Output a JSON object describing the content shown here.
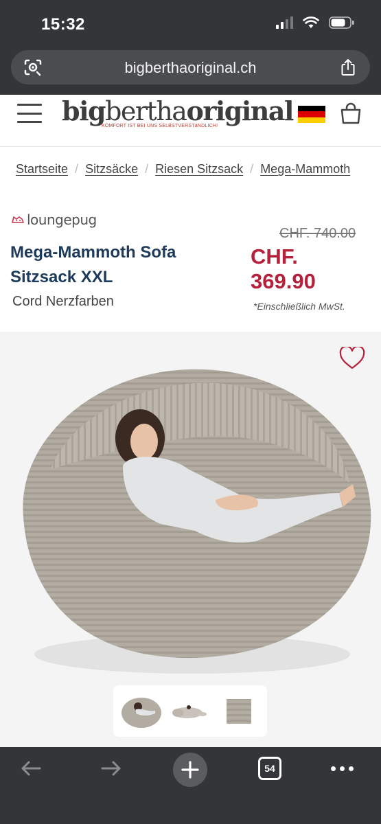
{
  "status_bar": {
    "time": "15:32"
  },
  "browser": {
    "url": "bigberthaoriginal.ch",
    "tab_count": "54"
  },
  "header": {
    "logo_text_1": "big",
    "logo_text_2": "bertha",
    "logo_text_3": "original",
    "logo_tagline": "KOMFORT IST BEI UNS SELBSTVERSTäNDLICH!",
    "flag_colors": [
      "#000000",
      "#dd0000",
      "#ffce00"
    ]
  },
  "breadcrumb": {
    "items": [
      "Startseite",
      "Sitzsäcke",
      "Riesen Sitzsack",
      "Mega-Mammoth"
    ]
  },
  "product": {
    "brand": "loungepug",
    "title": "Mega-Mammoth Sofa Sitzsack XXL",
    "variant": "Cord Nerzfarben",
    "old_price": "CHF. 740.00",
    "new_price": "CHF. 369.90",
    "vat_note": "*Einschließlich MwSt."
  },
  "colors": {
    "title": "#1e3a5a",
    "price": "#b5213a",
    "beanbag": "#b3aca3"
  }
}
